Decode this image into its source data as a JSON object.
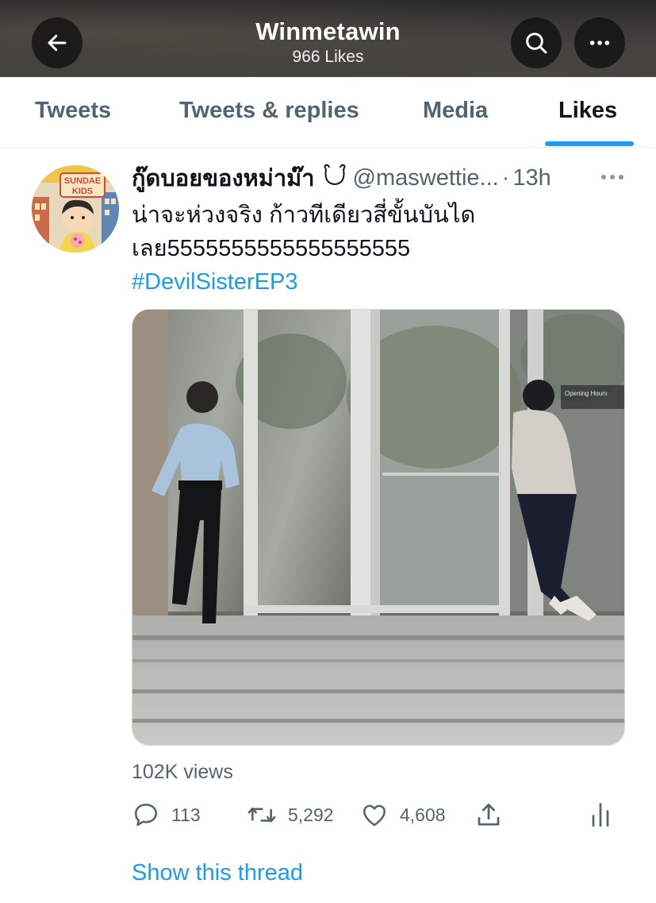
{
  "header": {
    "title": "Winmetawin",
    "subtitle": "966 Likes",
    "back_icon": "arrow-left-icon",
    "search_icon": "search-icon",
    "more_icon": "more-horizontal-icon"
  },
  "tabs": [
    {
      "label": "Tweets",
      "active": false
    },
    {
      "label": "Tweets & replies",
      "active": false
    },
    {
      "label": "Media",
      "active": false
    },
    {
      "label": "Likes",
      "active": true
    }
  ],
  "tweet": {
    "author_name": "กู๊ดบอยของหม่าม๊า",
    "name_emoji": "ʕ•ᴥ•ʔ",
    "handle": "@maswettie...",
    "separator": "·",
    "time": "13h",
    "text_line1": "น่าจะห่วงจริง ก้าวทีเดียวสี่ขั้นบันได",
    "text_line2": "เลย5555555555555555555",
    "hashtag": "#DevilSisterEP3",
    "avatar_text_top": "SUNDAE",
    "avatar_text_bottom": "KIDS",
    "media_sign_text": "Opening Hours",
    "views": "102K views",
    "actions": {
      "reply_count": "113",
      "retweet_count": "5,292",
      "like_count": "4,608"
    },
    "show_thread": "Show this thread"
  },
  "colors": {
    "accent": "#1d9bf0",
    "secondary_text": "#536471",
    "primary_text": "#0f1419"
  }
}
